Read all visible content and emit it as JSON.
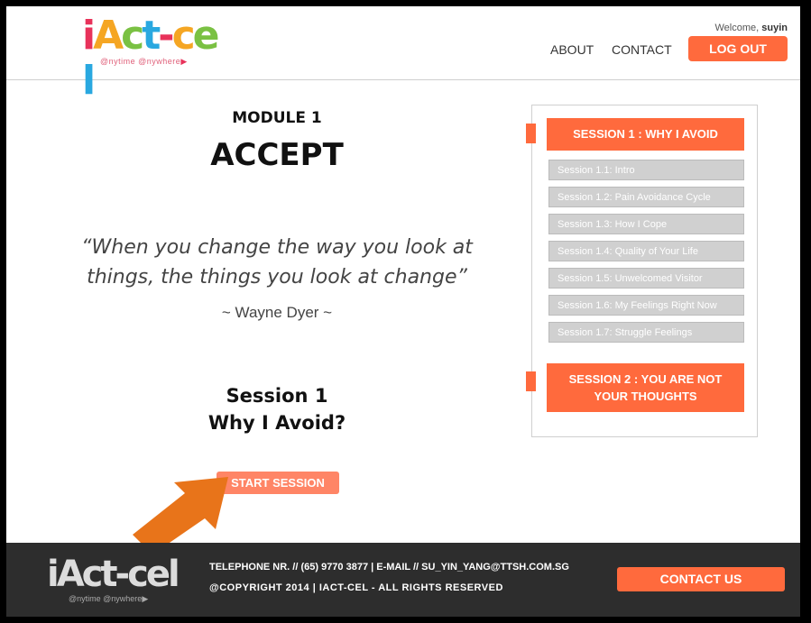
{
  "header": {
    "logo_text": "iAct-cel",
    "logo_tagline": "@nytime @nywhere",
    "welcome_prefix": "Welcome,",
    "username": "suyin",
    "nav": {
      "about": "ABOUT",
      "contact": "CONTACT"
    },
    "logout": "LOG OUT"
  },
  "main": {
    "module_label": "MODULE 1",
    "module_title": "ACCEPT",
    "quote_line1": "“When you change the way you look at",
    "quote_line2": "things, the things you look at change”",
    "quote_author": "~ Wayne Dyer ~",
    "session_line1": "Session 1",
    "session_line2": "Why I Avoid?",
    "start_button": "START SESSION"
  },
  "sessions_panel": {
    "session1": {
      "title": "SESSION 1 : WHY I AVOID",
      "items": [
        "Session 1.1: Intro",
        "Session 1.2: Pain Avoidance Cycle",
        "Session 1.3: How I Cope",
        "Session 1.4: Quality of Your Life",
        "Session 1.5: Unwelcomed Visitor",
        "Session 1.6: My Feelings Right Now",
        "Session 1.7: Struggle Feelings"
      ]
    },
    "session2": {
      "title_line1": "SESSION 2 : YOU ARE NOT",
      "title_line2": "YOUR THOUGHTS"
    }
  },
  "footer": {
    "logo_text": "iAct-cel",
    "logo_tagline": "@nytime @nywhere",
    "contact_line": "TELEPHONE NR. // (65) 9770 3877 | E-MAIL // SU_YIN_YANG@TTSH.COM.SG",
    "copyright_line": "@COPYRIGHT 2014 | IACT-CEL - ALL RIGHTS RESERVED",
    "contact_button": "CONTACT US"
  },
  "colors": {
    "accent": "#ff6a3d",
    "start_button": "#ff8566",
    "annotation_arrow": "#e8741a",
    "footer_bg": "#2d2d2d",
    "sub_item_bg": "#d0d0d0"
  }
}
